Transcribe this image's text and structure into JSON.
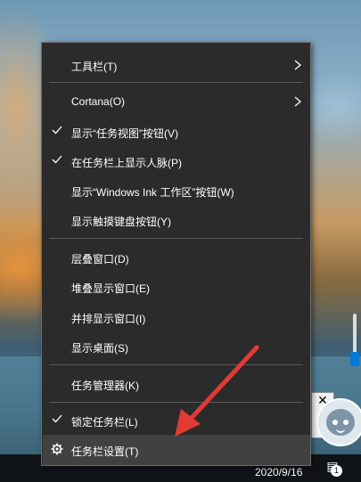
{
  "menu": {
    "items": [
      {
        "label": "工具栏(T)",
        "submenu": true,
        "checked": false
      },
      {
        "label": "Cortana(O)",
        "submenu": true,
        "checked": false
      },
      {
        "label": "显示“任务视图”按钮(V)",
        "submenu": false,
        "checked": true
      },
      {
        "label": "在任务栏上显示人脉(P)",
        "submenu": false,
        "checked": true
      },
      {
        "label": "显示“Windows Ink 工作区”按钮(W)",
        "submenu": false,
        "checked": false
      },
      {
        "label": "显示触摸键盘按钮(Y)",
        "submenu": false,
        "checked": false
      },
      {
        "label": "层叠窗口(D)",
        "submenu": false,
        "checked": false
      },
      {
        "label": "堆叠显示窗口(E)",
        "submenu": false,
        "checked": false
      },
      {
        "label": "并排显示窗口(I)",
        "submenu": false,
        "checked": false
      },
      {
        "label": "显示桌面(S)",
        "submenu": false,
        "checked": false
      },
      {
        "label": "任务管理器(K)",
        "submenu": false,
        "checked": false
      },
      {
        "label": "锁定任务栏(L)",
        "submenu": false,
        "checked": true
      },
      {
        "label": "任务栏设置(T)",
        "submenu": false,
        "checked": false,
        "icon": "gear-icon",
        "highlighted": true
      }
    ]
  },
  "taskbar": {
    "date": "2020/9/16",
    "notification_count": "1"
  },
  "colors": {
    "menu_bg": "#2b2b2b",
    "menu_hover": "#414141",
    "annotation_arrow": "#e23a35",
    "accent": "#0078d7"
  }
}
